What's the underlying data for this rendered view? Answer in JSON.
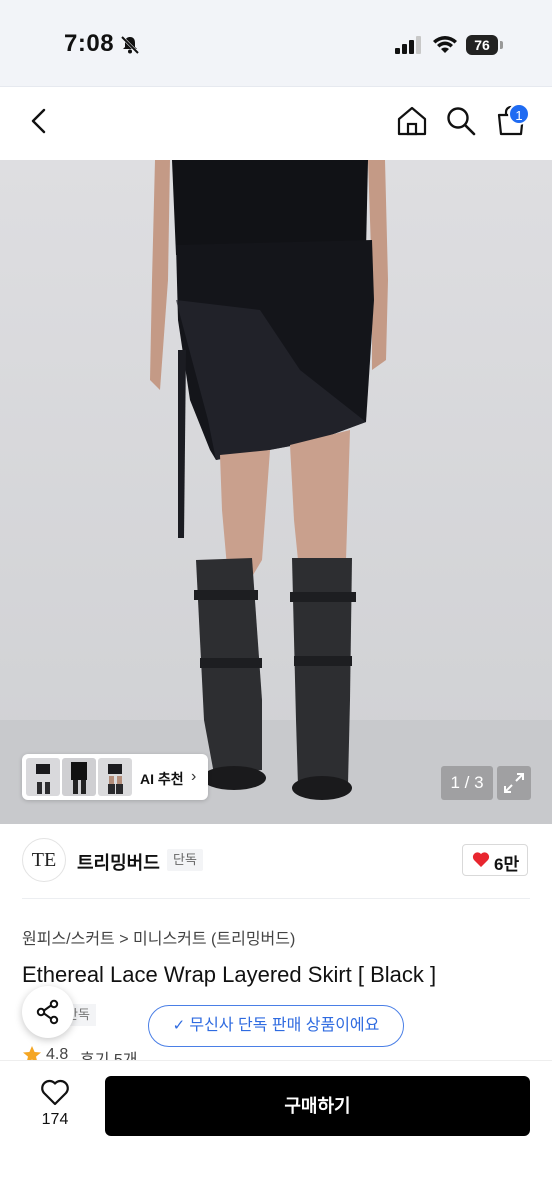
{
  "status_bar": {
    "time": "7:08",
    "battery": "76"
  },
  "nav": {
    "cart_count": "1"
  },
  "gallery": {
    "ai_label": "AI 추천",
    "page_indicator": "1 / 3"
  },
  "brand": {
    "logo_text": "TE",
    "name": "트리밍버드",
    "exclusive_tag": "단독",
    "like_count": "6만"
  },
  "product": {
    "breadcrumb": "원피스/스커트 > 미니스커트 (트리밍버드)",
    "title": "Ethereal Lace Wrap Layered Skirt [ Black ]",
    "tag": "단독",
    "rating": "4.8",
    "reviews": "후기 5개"
  },
  "notice": {
    "text": "무신사 단독 판매 상품이에요"
  },
  "bottom_bar": {
    "wish_count": "174",
    "buy_label": "구매하기"
  },
  "colors": {
    "accent_blue": "#1f6bf2",
    "heart_red": "#e8262f",
    "buy_black": "#000000",
    "star_orange": "#f5a623"
  }
}
